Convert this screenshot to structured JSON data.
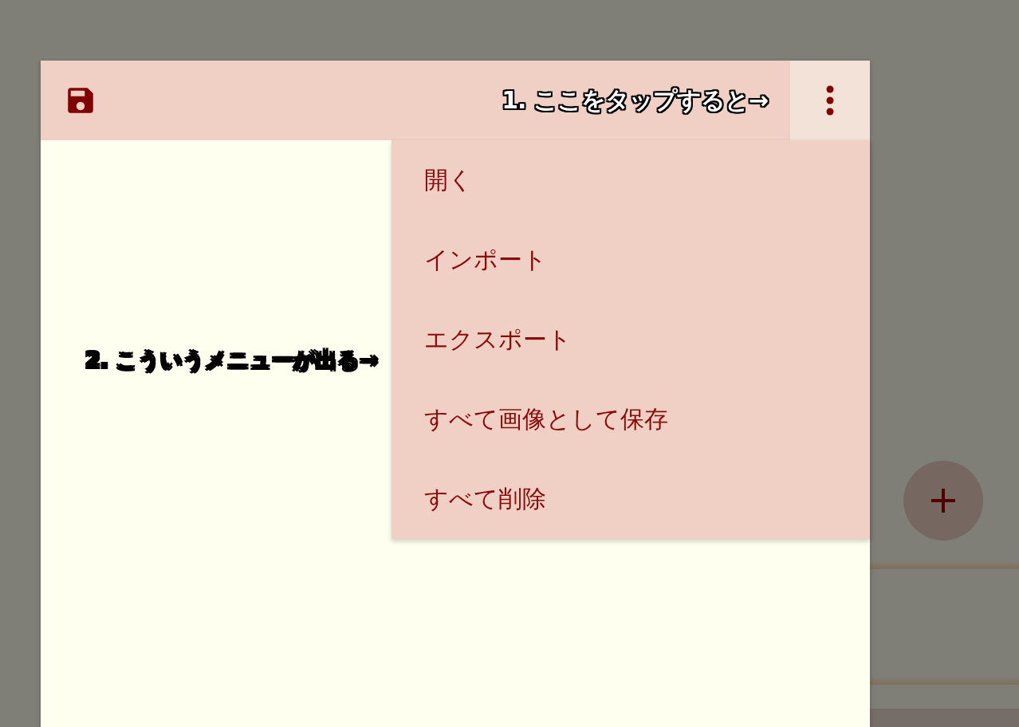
{
  "annotations": [
    {
      "text": "1. ここをタップすると→"
    },
    {
      "text": "2. こういうメニューが出る→"
    }
  ],
  "menu": {
    "items": [
      {
        "label": "開く"
      },
      {
        "label": "インポート"
      },
      {
        "label": "エクスポート"
      },
      {
        "label": "すべて画像として保存"
      },
      {
        "label": "すべて削除"
      }
    ]
  }
}
